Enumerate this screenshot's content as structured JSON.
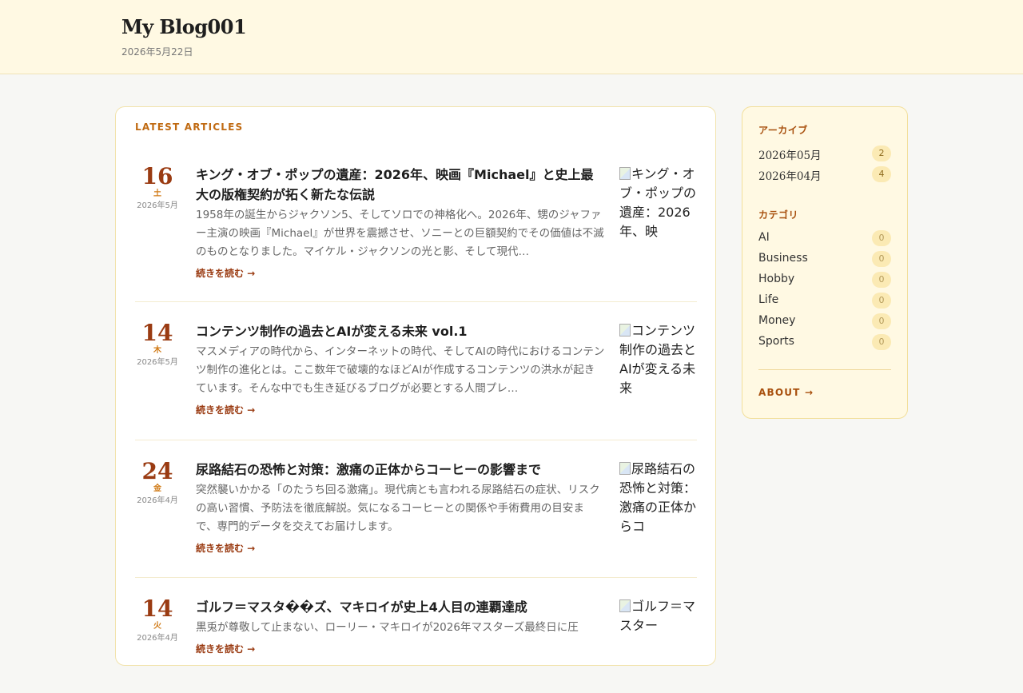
{
  "header": {
    "site_title": "My Blog001",
    "date": "2026年5月22日"
  },
  "main": {
    "section_label": "LATEST ARTICLES",
    "articles": [
      {
        "day": "16",
        "dow": "土",
        "ym": "2026年5月",
        "title": "キング・オブ・ポップの遺産：2026年、映画『Michael』と史上最大の版権契約が拓く新たな伝説",
        "excerpt": "1958年の誕生からジャクソン5、そしてソロでの神格化へ。2026年、甥のジャファー主演の映画『Michael』が世界を震撼させ、ソニーとの巨額契約でその価値は不滅のものとなりました。マイケル・ジャクソンの光と影、そして現代…",
        "readmore": "続きを読む →",
        "thumb_alt": "キング・オブ・ポップの遺産：2026年、映"
      },
      {
        "day": "14",
        "dow": "木",
        "ym": "2026年5月",
        "title": "コンテンツ制作の過去とAIが変える未来 vol.1",
        "excerpt": "マスメディアの時代から、インターネットの時代、そしてAIの時代におけるコンテンツ制作の進化とは。ここ数年で破壊的なほどAIが作成するコンテンツの洪水が起きています。そんな中でも生き延びるブログが必要とする人間プレ…",
        "readmore": "続きを読む →",
        "thumb_alt": "コンテンツ制作の過去とAIが変える未来"
      },
      {
        "day": "24",
        "dow": "金",
        "ym": "2026年4月",
        "title": "尿路結石の恐怖と対策：激痛の正体からコーヒーの影響まで",
        "excerpt": "突然襲いかかる「のたうち回る激痛」。現代病とも言われる尿路結石の症状、リスクの高い習慣、予防法を徹底解説。気になるコーヒーとの関係や手術費用の目安まで、専門的データを交えてお届けします。",
        "readmore": "続きを読む →",
        "thumb_alt": "尿路結石の恐怖と対策：激痛の正体からコ"
      },
      {
        "day": "14",
        "dow": "火",
        "ym": "2026年4月",
        "title": "ゴルフ＝マスタ��ズ、マキロイが史上4人目の連覇達成",
        "excerpt": "黒兎が尊敬して止まない、ローリー・マキロイが2026年マスターズ最終日に圧",
        "readmore": "続きを読む →",
        "thumb_alt": "ゴルフ＝マスター"
      }
    ]
  },
  "sidebar": {
    "archive_heading": "アーカイブ",
    "archives": [
      {
        "label": "2026年05月",
        "count": "2"
      },
      {
        "label": "2026年04月",
        "count": "4"
      }
    ],
    "category_heading": "カテゴリ",
    "categories": [
      {
        "label": "AI",
        "count": "0"
      },
      {
        "label": "Business",
        "count": "0"
      },
      {
        "label": "Hobby",
        "count": "0"
      },
      {
        "label": "Life",
        "count": "0"
      },
      {
        "label": "Money",
        "count": "0"
      },
      {
        "label": "Sports",
        "count": "0"
      }
    ],
    "about_label": "ABOUT →"
  }
}
